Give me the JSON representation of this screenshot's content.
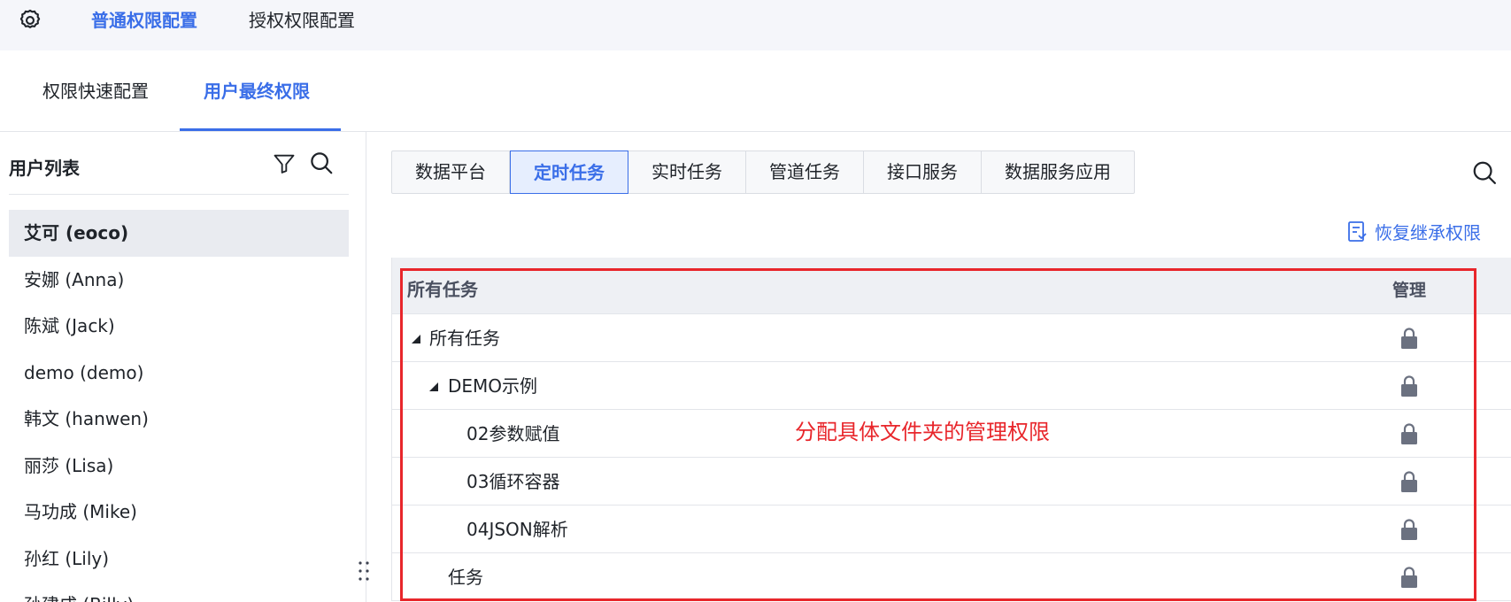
{
  "colors": {
    "accent": "#3a6ee8",
    "annotation": "#e8262b",
    "lock": "#6b7180"
  },
  "topbar": {
    "settings_icon": "gear-icon",
    "tabs": [
      {
        "label": "普通权限配置",
        "active": true
      },
      {
        "label": "授权权限配置",
        "active": false
      }
    ]
  },
  "subtabs": [
    {
      "label": "权限快速配置",
      "active": false
    },
    {
      "label": "用户最终权限",
      "active": true
    }
  ],
  "sidebar": {
    "title": "用户列表",
    "filter_icon": "filter-icon",
    "search_icon": "search-icon",
    "users": [
      {
        "label": "艾可 (eoco)",
        "selected": true
      },
      {
        "label": "安娜 (Anna)"
      },
      {
        "label": "陈斌 (Jack)"
      },
      {
        "label": "demo (demo)"
      },
      {
        "label": "韩文 (hanwen)"
      },
      {
        "label": "丽莎 (Lisa)"
      },
      {
        "label": "马功成 (Mike)"
      },
      {
        "label": "孙红 (Lily)"
      },
      {
        "label": "孙建成 (Billy)"
      }
    ]
  },
  "main": {
    "category_tabs": [
      {
        "label": "数据平台"
      },
      {
        "label": "定时任务",
        "active": true
      },
      {
        "label": "实时任务"
      },
      {
        "label": "管道任务"
      },
      {
        "label": "接口服务"
      },
      {
        "label": "数据服务应用"
      }
    ],
    "search_icon": "search-icon",
    "restore_label": "恢复继承权限",
    "table": {
      "col_name": "所有任务",
      "col_manage": "管理",
      "rows": [
        {
          "label": "所有任务",
          "expanded": true,
          "level": 0,
          "icon": "lock-icon"
        },
        {
          "label": "DEMO示例",
          "expanded": true,
          "level": 1,
          "icon": "lock-icon"
        },
        {
          "label": "02参数赋值",
          "level": 2,
          "icon": "lock-icon"
        },
        {
          "label": "03循环容器",
          "level": 2,
          "icon": "lock-icon"
        },
        {
          "label": "04JSON解析",
          "level": 2,
          "icon": "lock-icon"
        },
        {
          "label": "任务",
          "level": 1,
          "icon": "lock-icon"
        }
      ]
    },
    "annotation": "分配具体文件夹的管理权限"
  }
}
